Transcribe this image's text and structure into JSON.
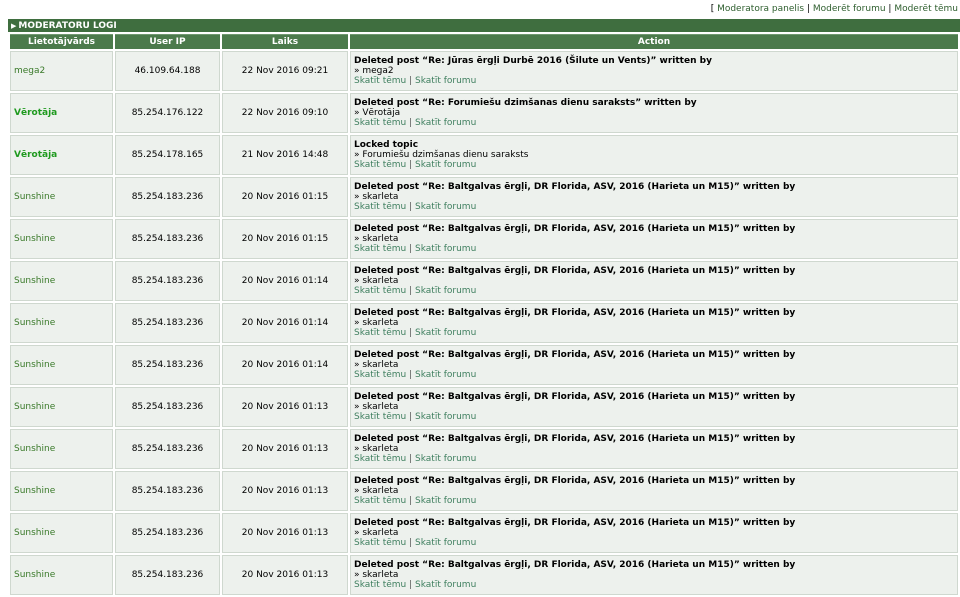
{
  "topnav": {
    "open": "[ ",
    "links": [
      "Moderatora panelis",
      "Moderēt forumu",
      "Moderēt tēmu"
    ],
    "separator": " | "
  },
  "title": "MODERATORU LOGI",
  "columns": [
    "Lietotājvārds",
    "User IP",
    "Laiks",
    "Action"
  ],
  "row_links": [
    "Skatīt tēmu",
    "Skatīt forumu"
  ],
  "rows": [
    {
      "user": "mega2",
      "bold": false,
      "ip": "46.109.64.188",
      "time": "22 Nov 2016 09:21",
      "action": "Deleted post “Re: Jūras ērgļi Durbē 2016 (Šilute un Vents)” written by",
      "detail": "» mega2"
    },
    {
      "user": "Vērotāja",
      "bold": true,
      "ip": "85.254.176.122",
      "time": "22 Nov 2016 09:10",
      "action": "Deleted post “Re: Forumiešu dzimšanas dienu saraksts” written by",
      "detail": "» Vērotāja"
    },
    {
      "user": "Vērotāja",
      "bold": true,
      "ip": "85.254.178.165",
      "time": "21 Nov 2016 14:48",
      "action": "Locked topic",
      "detail": "» Forumiešu dzimšanas dienu saraksts"
    },
    {
      "user": "Sunshine",
      "bold": false,
      "ip": "85.254.183.236",
      "time": "20 Nov 2016 01:15",
      "action": "Deleted post “Re: Baltgalvas ērgļi, DR Florida, ASV, 2016 (Harieta un M15)” written by",
      "detail": "» skarleta"
    },
    {
      "user": "Sunshine",
      "bold": false,
      "ip": "85.254.183.236",
      "time": "20 Nov 2016 01:15",
      "action": "Deleted post “Re: Baltgalvas ērgļi, DR Florida, ASV, 2016 (Harieta un M15)” written by",
      "detail": "» skarleta"
    },
    {
      "user": "Sunshine",
      "bold": false,
      "ip": "85.254.183.236",
      "time": "20 Nov 2016 01:14",
      "action": "Deleted post “Re: Baltgalvas ērgļi, DR Florida, ASV, 2016 (Harieta un M15)” written by",
      "detail": "» skarleta"
    },
    {
      "user": "Sunshine",
      "bold": false,
      "ip": "85.254.183.236",
      "time": "20 Nov 2016 01:14",
      "action": "Deleted post “Re: Baltgalvas ērgļi, DR Florida, ASV, 2016 (Harieta un M15)” written by",
      "detail": "» skarleta"
    },
    {
      "user": "Sunshine",
      "bold": false,
      "ip": "85.254.183.236",
      "time": "20 Nov 2016 01:14",
      "action": "Deleted post “Re: Baltgalvas ērgļi, DR Florida, ASV, 2016 (Harieta un M15)” written by",
      "detail": "» skarleta"
    },
    {
      "user": "Sunshine",
      "bold": false,
      "ip": "85.254.183.236",
      "time": "20 Nov 2016 01:13",
      "action": "Deleted post “Re: Baltgalvas ērgļi, DR Florida, ASV, 2016 (Harieta un M15)” written by",
      "detail": "» skarleta"
    },
    {
      "user": "Sunshine",
      "bold": false,
      "ip": "85.254.183.236",
      "time": "20 Nov 2016 01:13",
      "action": "Deleted post “Re: Baltgalvas ērgļi, DR Florida, ASV, 2016 (Harieta un M15)” written by",
      "detail": "» skarleta"
    },
    {
      "user": "Sunshine",
      "bold": false,
      "ip": "85.254.183.236",
      "time": "20 Nov 2016 01:13",
      "action": "Deleted post “Re: Baltgalvas ērgļi, DR Florida, ASV, 2016 (Harieta un M15)” written by",
      "detail": "» skarleta"
    },
    {
      "user": "Sunshine",
      "bold": false,
      "ip": "85.254.183.236",
      "time": "20 Nov 2016 01:13",
      "action": "Deleted post “Re: Baltgalvas ērgļi, DR Florida, ASV, 2016 (Harieta un M15)” written by",
      "detail": "» skarleta"
    },
    {
      "user": "Sunshine",
      "bold": false,
      "ip": "85.254.183.236",
      "time": "20 Nov 2016 01:13",
      "action": "Deleted post “Re: Baltgalvas ērgļi, DR Florida, ASV, 2016 (Harieta un M15)” written by",
      "detail": "» skarleta"
    }
  ]
}
